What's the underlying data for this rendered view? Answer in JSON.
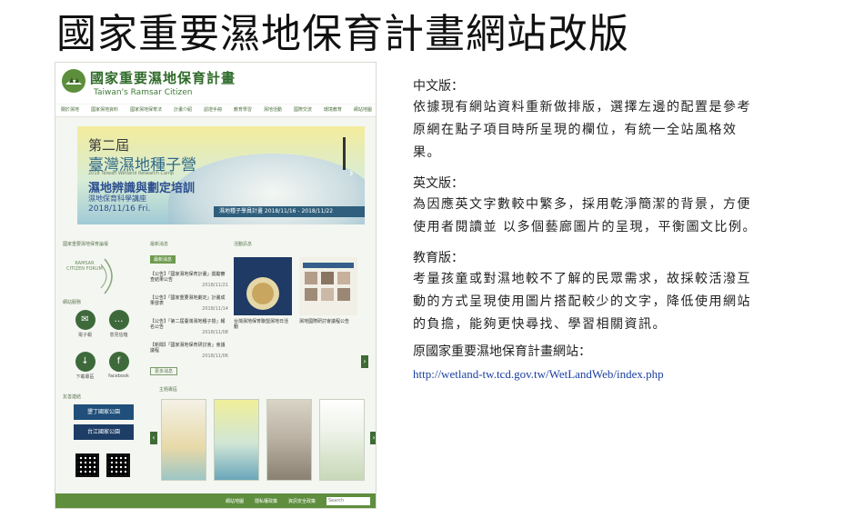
{
  "slide": {
    "title": "國家重要濕地保育計畫網站改版"
  },
  "site": {
    "logo_cn": "國家重要濕地保育計畫",
    "logo_en": "Taiwan's Ramsar Citizen",
    "nav": [
      "關於濕地",
      "國家濕地資料",
      "國家濕地保育法",
      "計畫介紹",
      "認證手冊",
      "教育學習",
      "濕地活動",
      "國際交流",
      "環境教育",
      "網站地圖"
    ],
    "banner": {
      "line1": "第二屆",
      "line2": "臺灣濕地種子營",
      "line3": "2018 Taiwan Wetland Research Camp",
      "line4": "濕地辨識與劃定培訓",
      "line5": "濕地保育科學講座",
      "line6": "2018/11/16 Fri.",
      "strip": "濕地種子學員計畫 2018/11/16 - 2018/11/22"
    },
    "left": {
      "forum_heading": "國家重要濕地保育論壇",
      "forum_text": "RAMSAR CITIZEN FORUM",
      "service_heading": "網站服務",
      "services": [
        {
          "icon": "email-icon",
          "glyph": "✉",
          "label": "電子報"
        },
        {
          "icon": "chat-icon",
          "glyph": "…",
          "label": "意見信箱"
        },
        {
          "icon": "download-icon",
          "glyph": "↓",
          "label": "下載專區"
        },
        {
          "icon": "facebook-icon",
          "glyph": "f",
          "label": "facebook"
        }
      ],
      "links_heading": "友善連結",
      "partners": [
        "墾丁國家公園",
        "台江國家公園"
      ]
    },
    "news": {
      "heading": "最新消息",
      "tab": "最新消息",
      "items": [
        {
          "text": "【公告】「國家濕地保育計畫」獎勵審查結果公告",
          "date": "2018/11/21"
        },
        {
          "text": "【公告】「國家重要濕地劃定」計畫成果發表",
          "date": "2018/11/14"
        },
        {
          "text": "【公告】「第二屆臺灣濕地種子營」報名公告",
          "date": "2018/11/08"
        },
        {
          "text": "【新聞】「國家濕地保育研討會」會議議程",
          "date": "2018/11/06"
        }
      ],
      "more": "更多消息"
    },
    "activity": {
      "heading": "活動訊息",
      "captions": [
        "台灣濕地保育聯盟濕地日活動",
        "第二屆臺灣濕地種子營報名",
        "濕地國際研討會議程公告"
      ]
    },
    "topics": {
      "heading": "主題專區"
    },
    "footer": {
      "links": [
        "網站地圖",
        "隱私權政策",
        "資訊安全政策"
      ],
      "search_placeholder": "Search"
    }
  },
  "description": {
    "sections": [
      {
        "label": "中文版：",
        "text": "依據現有網站資料重新做排版，選擇左邊的配置是參考原網在點子項目時所呈現的欄位，有統一全站風格效果。"
      },
      {
        "label": "英文版：",
        "text": "為因應英文字數較中繁多，採用乾淨簡潔的背景，方便使用者閱讀並 以多個藝廊圖片的呈現，平衡圖文比例。"
      },
      {
        "label": "教育版：",
        "text": "考量孩童或對濕地較不了解的民眾需求，故採較活潑互動的方式呈現使用圖片搭配較少的文字，降低使用網站的負擔，能夠更快尋找、學習相關資訊。"
      }
    ],
    "original_label": "原國家重要濕地保育計畫網站：",
    "original_url": "http://wetland-tw.tcd.gov.tw/WetLandWeb/index.php"
  }
}
